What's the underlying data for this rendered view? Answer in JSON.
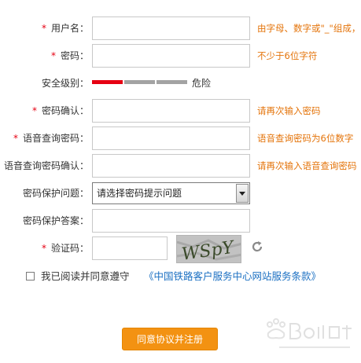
{
  "form": {
    "username": {
      "label": "用户名：",
      "hint": "由字母、数字或\"_\"组成，"
    },
    "password": {
      "label": "密码：",
      "hint": "不少于6位字符"
    },
    "strength": {
      "label": "安全级别：",
      "text": "危险",
      "colors": {
        "filled": "#e60012",
        "empty": "#a3a3a3"
      }
    },
    "confirm_password": {
      "label": "密码确认：",
      "hint": "请再次输入密码"
    },
    "voice_password": {
      "label": "语音查询密码：",
      "hint": "语音查询密码为6位数字"
    },
    "voice_password_confirm": {
      "label": "语音查询密码确认：",
      "hint": "请再次输入语音查询密码"
    },
    "security_question": {
      "label": "密码保护问题：",
      "selected": "请选择密码提示问题"
    },
    "security_answer": {
      "label": "密码保护答案："
    },
    "captcha": {
      "label": "验证码：",
      "image_text": "WSpY"
    },
    "required_mark": "*"
  },
  "agreement": {
    "text": "我已阅读并同意遵守",
    "link": "《中国铁路客户服务中心网站服务条款》"
  },
  "submit_label": "同意协议并注册",
  "colors": {
    "hint": "#e4740b",
    "link": "#1a6fc2",
    "button": "#f39212",
    "required": "#e60012"
  }
}
